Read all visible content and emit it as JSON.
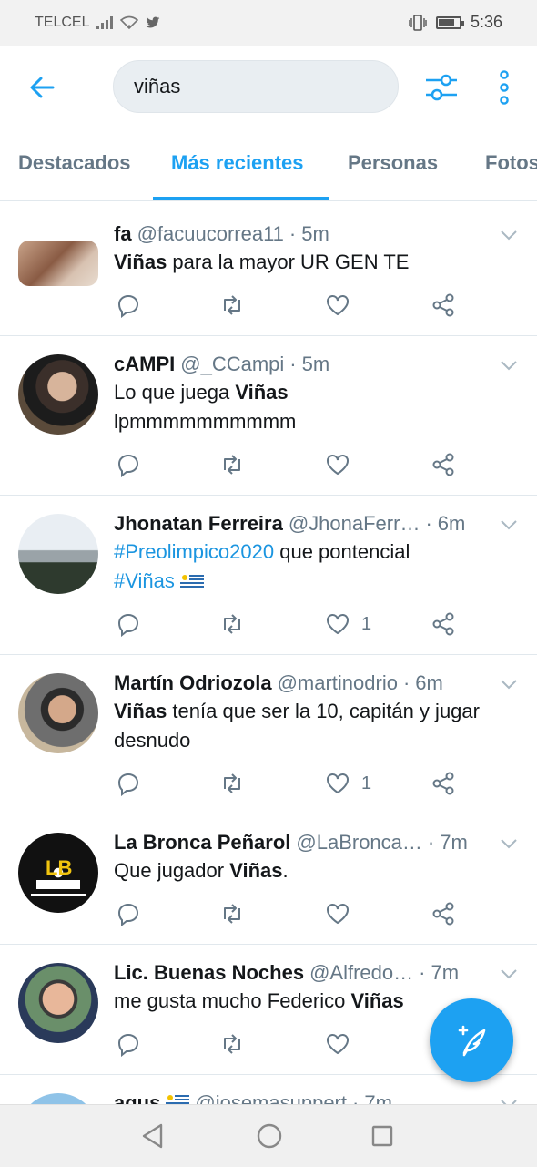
{
  "status": {
    "carrier": "TELCEL",
    "time": "5:36"
  },
  "search": {
    "query": "viñas"
  },
  "tabs": [
    "Destacados",
    "Más recientes",
    "Personas",
    "Fotos"
  ],
  "tweets": [
    {
      "name": "fa",
      "handle": "@facuucorrea11",
      "time": "5m",
      "b1": "Viñas",
      "t1": " para la mayor UR GEN TE"
    },
    {
      "name": "cAMPI",
      "handle": "@_CCampi",
      "time": "5m",
      "t1": "Lo que juega ",
      "b1": "Viñas",
      "t2": "lpmmmmmmmmmm"
    },
    {
      "name": "Jhonatan Ferreira",
      "handle": "@JhonaFerr…",
      "time": "6m",
      "l1": "#Preolimpico2020",
      "t1": " que pontencial",
      "l2": "#Viñas",
      "likes": "1"
    },
    {
      "name": "Martín Odriozola",
      "handle": "@martinodrio",
      "time": "6m",
      "b1": "Viñas",
      "t1": " tenía que ser la 10, capitán y jugar",
      "t2": "desnudo",
      "likes": "1"
    },
    {
      "name": "La Bronca Peñarol",
      "handle": "@LaBronca…",
      "time": "7m",
      "t1": "Que jugador ",
      "b1": "Viñas",
      "t2": "."
    },
    {
      "name": "Lic. Buenas Noches",
      "handle": "@Alfredo…",
      "time": "7m",
      "t1": "me gusta mucho Federico ",
      "b1": "Viñas"
    },
    {
      "name": "agus",
      "handle": "@josemasuppert",
      "time": "7m"
    }
  ],
  "colors": {
    "accent": "#1da1f2",
    "text": "#14171a",
    "secondary": "#657786"
  }
}
